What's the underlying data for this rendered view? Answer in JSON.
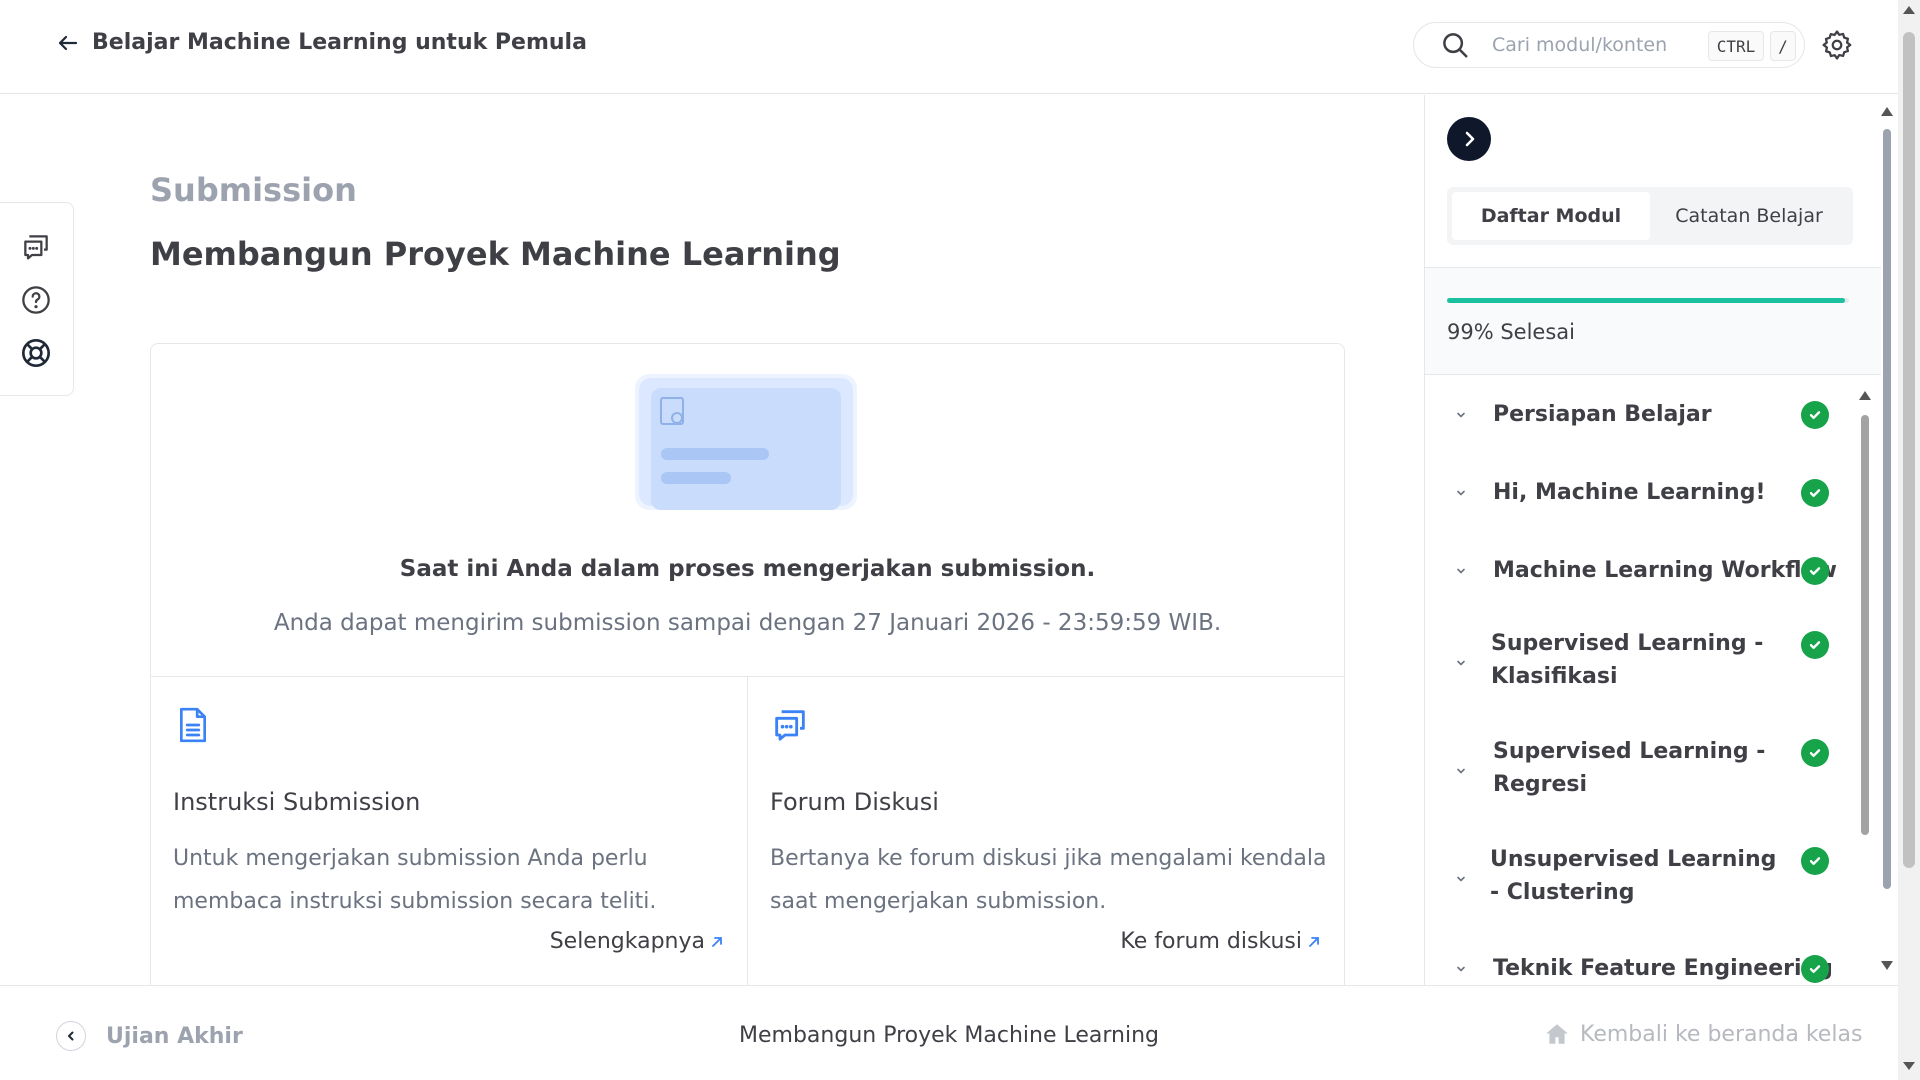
{
  "header": {
    "back_icon": "arrow-left-icon",
    "course_title": "Belajar Machine Learning untuk Pemula",
    "search": {
      "placeholder": "Cari modul/konten",
      "shortcut_ctrl": "CTRL",
      "shortcut_key": "/"
    },
    "settings_icon": "gear-icon"
  },
  "left_tools": [
    {
      "icon": "discussion-icon"
    },
    {
      "icon": "help-icon"
    },
    {
      "icon": "lifebuoy-icon"
    }
  ],
  "main": {
    "section_label": "Submission",
    "title": "Membangun Proyek Machine Learning",
    "card": {
      "status_title": "Saat ini Anda dalam proses mengerjakan submission.",
      "status_desc": "Anda dapat mengirim submission sampai dengan 27 Januari 2026 - 23:59:59 WIB.",
      "instructions": {
        "icon": "document-icon",
        "title": "Instruksi Submission",
        "text": "Untuk mengerjakan submission Anda perlu membaca instruksi submission secara teliti.",
        "link": "Selengkapnya"
      },
      "forum": {
        "icon": "discussion-icon",
        "title": "Forum Diskusi",
        "text": "Bertanya ke forum diskusi jika mengalami kendala saat mengerjakan submission.",
        "link": "Ke forum diskusi"
      }
    }
  },
  "sidebar": {
    "collapse_icon": "chevron-right-icon",
    "tabs": [
      "Daftar Modul",
      "Catatan Belajar"
    ],
    "active_tab": "Daftar Modul",
    "progress": {
      "percent": 99,
      "label": "99% Selesai"
    },
    "modules": [
      {
        "title": "Persiapan Belajar",
        "done": true
      },
      {
        "title": "Hi, Machine Learning!",
        "done": true
      },
      {
        "title": "Machine Learning Workflow",
        "done": true
      },
      {
        "title": "Supervised Learning - Klasifikasi",
        "done": true
      },
      {
        "title": "Supervised Learning - Regresi",
        "done": true
      },
      {
        "title": "Unsupervised Learning - Clustering",
        "done": true
      },
      {
        "title": "Teknik Feature Engineering",
        "done": true
      }
    ]
  },
  "footer": {
    "prev_label": "Ujian Akhir",
    "current_title": "Membangun Proyek Machine Learning",
    "home_label": "Kembali ke beranda kelas",
    "home_icon": "home-icon"
  },
  "colors": {
    "progress": "#1bc0a0",
    "check": "#16a34a",
    "dark": "#0f172a",
    "muted": "#9ca3af",
    "text": "#3f3f46"
  }
}
